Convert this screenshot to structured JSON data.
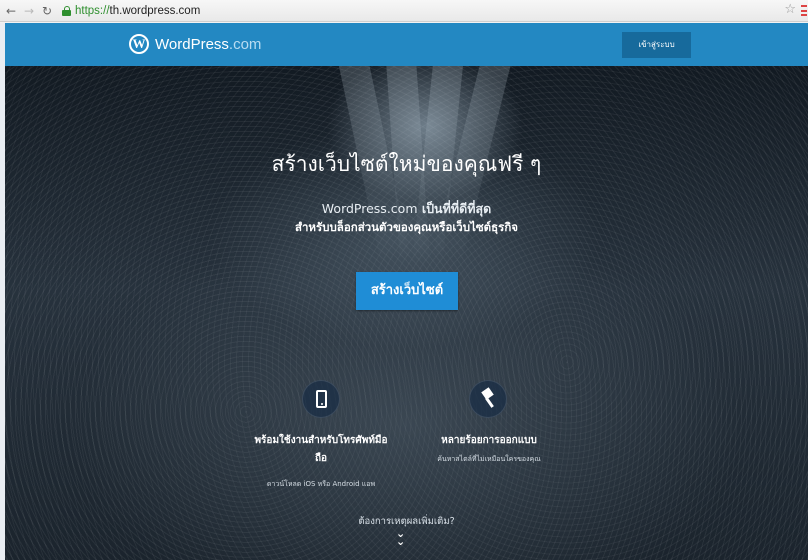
{
  "browser": {
    "url_scheme": "https://",
    "url_host": "th.wordpress.com"
  },
  "header": {
    "brand_main": "WordPress",
    "brand_tld": ".com",
    "login_label": "เข้าสู่ระบบ"
  },
  "hero": {
    "title": "สร้างเว็บไซต์ใหม่ของคุณฟรี ๆ",
    "subtitle_brand": "WordPress.com",
    "subtitle_rest": " เป็นที่ที่ดีที่สุด",
    "subtitle_line2": "สำหรับบล็อกส่วนตัวของคุณหรือเว็บไซต์ธุรกิจ",
    "cta_label": "สร้างเว็บไซต์"
  },
  "features": [
    {
      "icon": "phone-icon",
      "title_line1": "พร้อมใช้งานสำหรับโทรศัพท์มือ",
      "title_line2": "ถือ",
      "desc": "ดาวน์โหลด iOS หรือ Android แอพ"
    },
    {
      "icon": "paintbrush-icon",
      "title_line1": "หลายร้อยการออกแบบ",
      "title_line2": "",
      "desc": "ค้นหาสไตล์ที่ไม่เหมือนใครของคุณ"
    }
  ],
  "footer": {
    "more_label": "ต้องการเหตุผลเพิ่มเติม?"
  },
  "colors": {
    "masthead": "#2388c2",
    "cta": "#1f8dd6",
    "login": "#176a9c"
  }
}
